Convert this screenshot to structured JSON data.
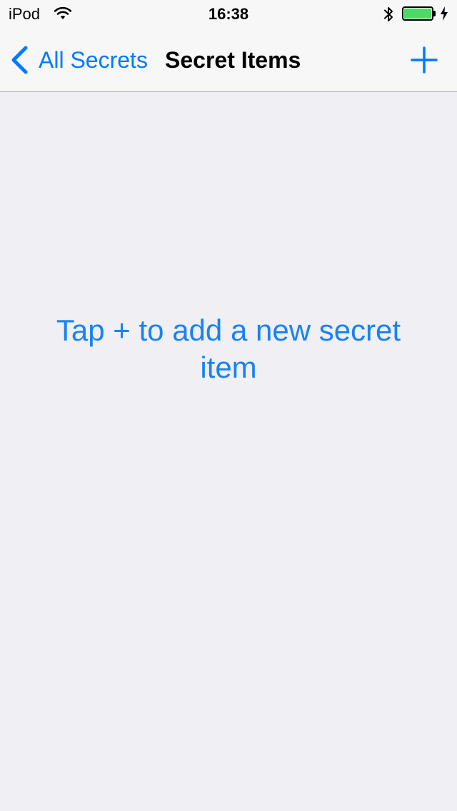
{
  "status_bar": {
    "carrier": "iPod",
    "time": "16:38",
    "wifi_icon": "wifi-icon",
    "bluetooth_icon": "bluetooth-icon",
    "battery_icon": "battery-icon",
    "battery_level": 1.0,
    "charging_icon": "charging-bolt-icon"
  },
  "nav": {
    "back_label": "All Secrets",
    "back_icon": "chevron-left-icon",
    "title": "Secret Items",
    "add_icon": "plus-icon"
  },
  "content": {
    "empty_message": "Tap + to add a new secret item"
  },
  "colors": {
    "tint": "#007aff",
    "message": "#1a82f0",
    "background": "#efeff4",
    "bar_background": "#f7f7f7",
    "battery_fill": "#4cd964"
  }
}
